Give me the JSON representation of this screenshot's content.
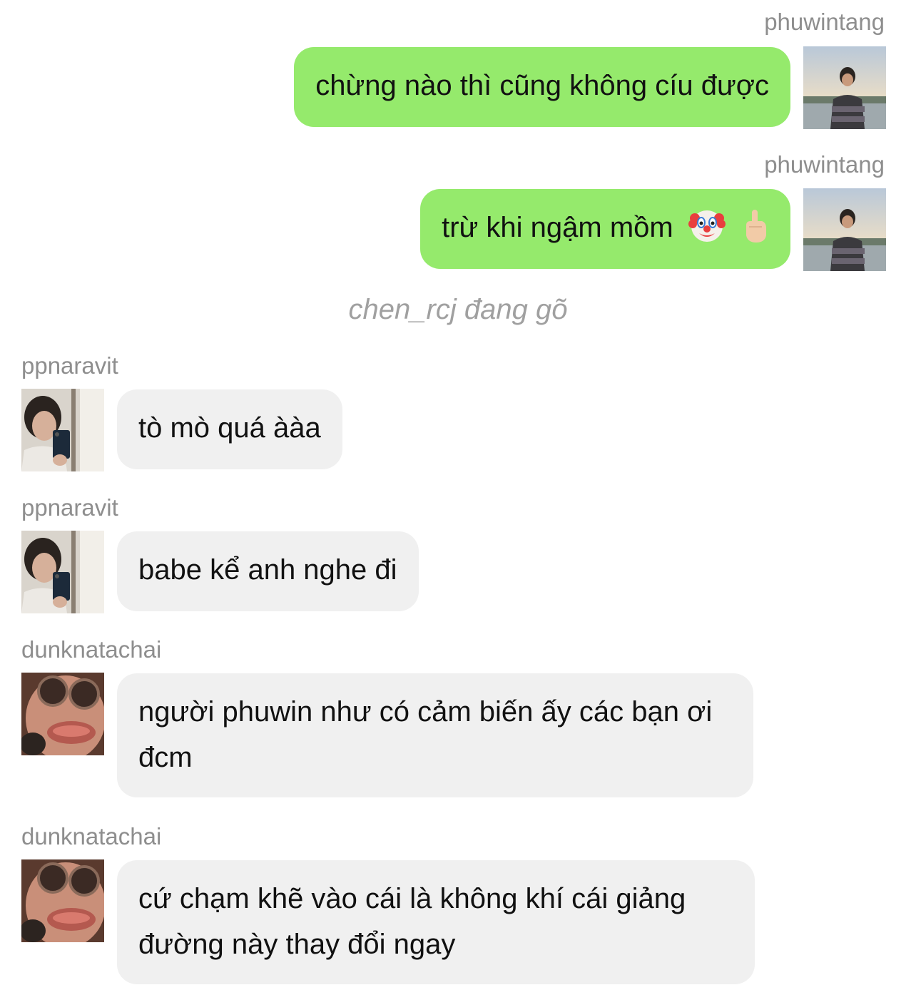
{
  "messages": [
    {
      "sender": "phuwintang",
      "text": "chừng nào thì cũng không cíu được",
      "direction": "out",
      "avatar": "outdoor-portrait-avatar"
    },
    {
      "sender": "phuwintang",
      "text": "trừ khi ngậm mồm",
      "emojis": [
        "clown-face-emoji",
        "raised-finger-emoji"
      ],
      "direction": "out",
      "avatar": "outdoor-portrait-avatar"
    },
    {
      "sender": "ppnaravit",
      "text": "tò mò quá ààa",
      "direction": "in",
      "avatar": "mirror-selfie-avatar"
    },
    {
      "sender": "ppnaravit",
      "text": "babe kể anh nghe đi",
      "direction": "in",
      "avatar": "mirror-selfie-avatar"
    },
    {
      "sender": "dunknatachai",
      "text": "người phuwin như có cảm biến ấy các bạn ơi đcm",
      "direction": "in",
      "avatar": "funny-face-avatar"
    },
    {
      "sender": "dunknatachai",
      "text": "cứ chạm khẽ vào cái là không khí cái giảng đường này thay đổi ngay",
      "direction": "in",
      "avatar": "funny-face-avatar"
    }
  ],
  "typing_indicator": "chen_rcj đang gõ",
  "colors": {
    "outgoing_bubble": "#95ea6c",
    "incoming_bubble": "#f0f0f0",
    "sender_name": "#8e8e8e",
    "typing_text": "#a0a0a0"
  }
}
